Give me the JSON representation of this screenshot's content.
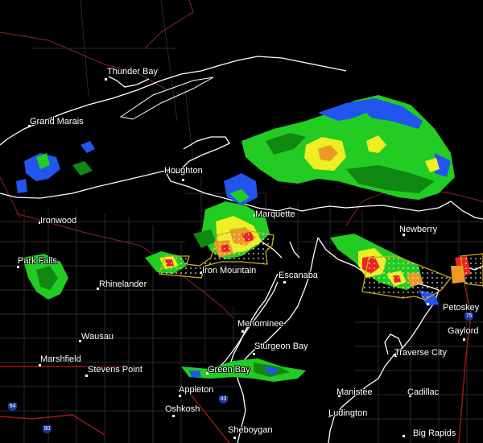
{
  "map": {
    "colors": {
      "background": "#000000",
      "shoreline": "#ffffff",
      "county_lines": "#3a3a3a",
      "state_lines": "#7a1f1f",
      "highways": "#a01818",
      "warning_polygon": "#ccaa22",
      "radar_green": "#22cc22",
      "radar_dark_green": "#118811",
      "radar_blue": "#2255ee",
      "radar_yellow": "#eeee22",
      "radar_orange": "#ee9922",
      "radar_red": "#ee2222"
    },
    "cities": [
      {
        "name": "Thunder Bay"
      },
      {
        "name": "Grand Marais"
      },
      {
        "name": "Houghton"
      },
      {
        "name": "Marquette"
      },
      {
        "name": "Newberry"
      },
      {
        "name": "Ironwood"
      },
      {
        "name": "Park Falls"
      },
      {
        "name": "Rhinelander"
      },
      {
        "name": "Iron Mountain"
      },
      {
        "name": "Escanaba"
      },
      {
        "name": "Petoskey"
      },
      {
        "name": "Gaylord"
      },
      {
        "name": "Menominee"
      },
      {
        "name": "Wausau"
      },
      {
        "name": "Sturgeon Bay"
      },
      {
        "name": "Marshfield"
      },
      {
        "name": "Traverse City"
      },
      {
        "name": "Stevens Point"
      },
      {
        "name": "Green Bay"
      },
      {
        "name": "Appleton"
      },
      {
        "name": "Manistee"
      },
      {
        "name": "Cadillac"
      },
      {
        "name": "Oshkosh"
      },
      {
        "name": "Ludington"
      },
      {
        "name": "Sheboygan"
      },
      {
        "name": "Big Rapids"
      }
    ],
    "shields": [
      {
        "label": "75",
        "kind": "interstate-shield-icon"
      },
      {
        "label": "43",
        "kind": "interstate-shield-icon"
      },
      {
        "label": "94",
        "kind": "interstate-shield-icon"
      },
      {
        "label": "90",
        "kind": "interstate-shield-icon"
      }
    ]
  }
}
